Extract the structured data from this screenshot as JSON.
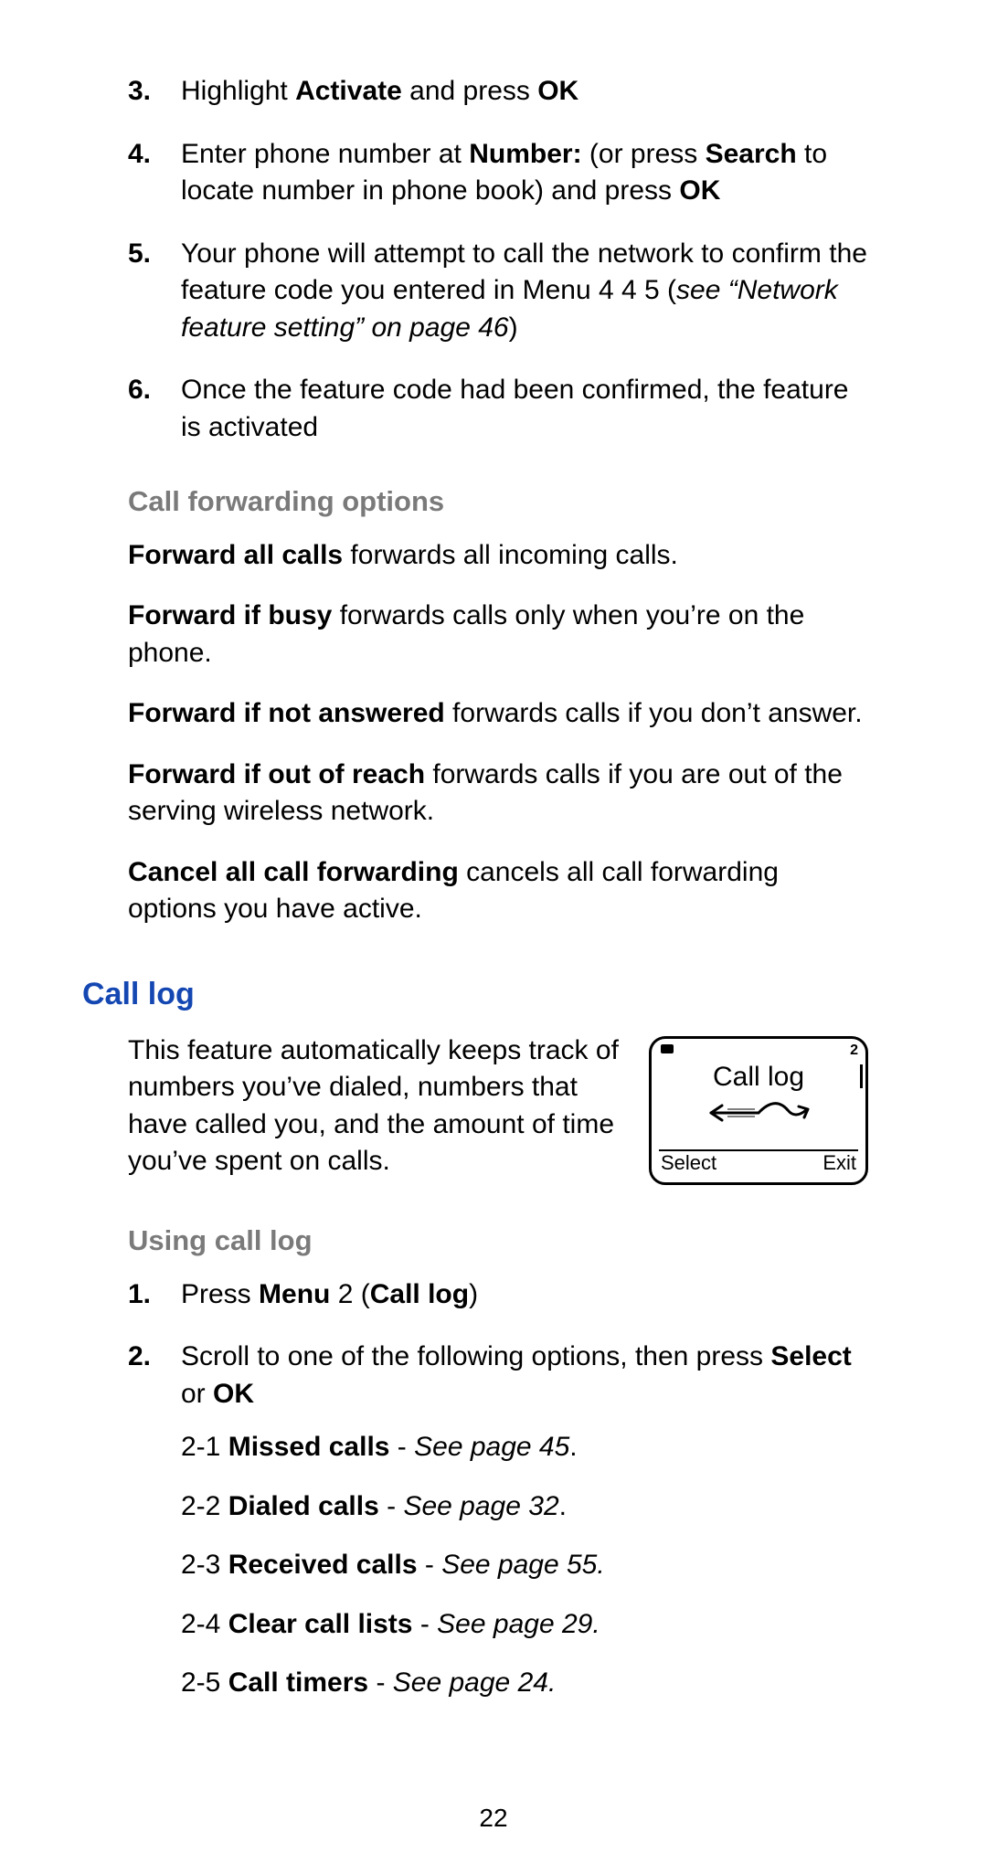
{
  "steps_top": [
    {
      "n": "3.",
      "parts": [
        {
          "t": "Highlight "
        },
        {
          "t": "Activate",
          "b": true
        },
        {
          "t": " and press "
        },
        {
          "t": "OK",
          "b": true
        }
      ]
    },
    {
      "n": "4.",
      "parts": [
        {
          "t": "Enter phone number at "
        },
        {
          "t": "Number:",
          "b": true
        },
        {
          "t": " (or press "
        },
        {
          "t": "Search",
          "b": true
        },
        {
          "t": " to locate number in phone book) and press "
        },
        {
          "t": "OK",
          "b": true
        }
      ]
    },
    {
      "n": "5.",
      "parts": [
        {
          "t": "Your phone will attempt to call the network to confirm the feature code you entered in Menu 4 4 5 ("
        },
        {
          "t": "see “Network feature setting” on page 46",
          "i": true
        },
        {
          "t": ")"
        }
      ]
    },
    {
      "n": "6.",
      "parts": [
        {
          "t": "Once the feature code had been confirmed, the feature is activated"
        }
      ]
    }
  ],
  "subhead_cfo": "Call forwarding options",
  "cfo_paras": [
    [
      {
        "t": "Forward all calls",
        "b": true
      },
      {
        "t": " forwards all incoming calls."
      }
    ],
    [
      {
        "t": "Forward if busy",
        "b": true
      },
      {
        "t": " forwards calls only when you’re on the phone."
      }
    ],
    [
      {
        "t": "Forward if not answered",
        "b": true
      },
      {
        "t": " forwards calls if you don’t answer."
      }
    ],
    [
      {
        "t": "Forward if out of reach",
        "b": true
      },
      {
        "t": " forwards calls if you are out of the serving wireless network."
      }
    ],
    [
      {
        "t": "Cancel all call forwarding",
        "b": true
      },
      {
        "t": " cancels all call forwarding options you have active."
      }
    ]
  ],
  "section_call_log": "Call log",
  "call_log_intro": "This feature automatically keeps track of numbers you’ve dialed, numbers that have called you, and the amount of time you’ve spent on calls.",
  "screen": {
    "indicator_num": "2",
    "title": "Call log",
    "sk_left": "Select",
    "sk_right": "Exit"
  },
  "subhead_ucl": "Using call log",
  "ucl_steps": [
    {
      "n": "1.",
      "parts": [
        {
          "t": "Press "
        },
        {
          "t": "Menu",
          "b": true
        },
        {
          "t": " 2 ("
        },
        {
          "t": "Call log",
          "b": true
        },
        {
          "t": ")"
        }
      ]
    },
    {
      "n": "2.",
      "parts": [
        {
          "t": "Scroll to one of the following options, then press "
        },
        {
          "t": "Select",
          "b": true
        },
        {
          "t": " or "
        },
        {
          "t": "OK",
          "b": true
        }
      ],
      "sub": [
        [
          {
            "t": "2-1 "
          },
          {
            "t": "Missed calls",
            "b": true
          },
          {
            "t": " - "
          },
          {
            "t": "See page 45",
            "i": true
          },
          {
            "t": "."
          }
        ],
        [
          {
            "t": "2-2 "
          },
          {
            "t": "Dialed calls",
            "b": true
          },
          {
            "t": " - "
          },
          {
            "t": "See page 32",
            "i": true
          },
          {
            "t": "."
          }
        ],
        [
          {
            "t": "2-3 "
          },
          {
            "t": "Received calls",
            "b": true
          },
          {
            "t": " - "
          },
          {
            "t": "See page 55.",
            "i": true
          }
        ],
        [
          {
            "t": "2-4 "
          },
          {
            "t": "Clear call lists",
            "b": true
          },
          {
            "t": " - "
          },
          {
            "t": "See page 29.",
            "i": true
          }
        ],
        [
          {
            "t": "2-5 "
          },
          {
            "t": "Call timers",
            "b": true
          },
          {
            "t": " - "
          },
          {
            "t": "See page 24.",
            "i": true
          }
        ]
      ]
    }
  ],
  "page_number": "22"
}
